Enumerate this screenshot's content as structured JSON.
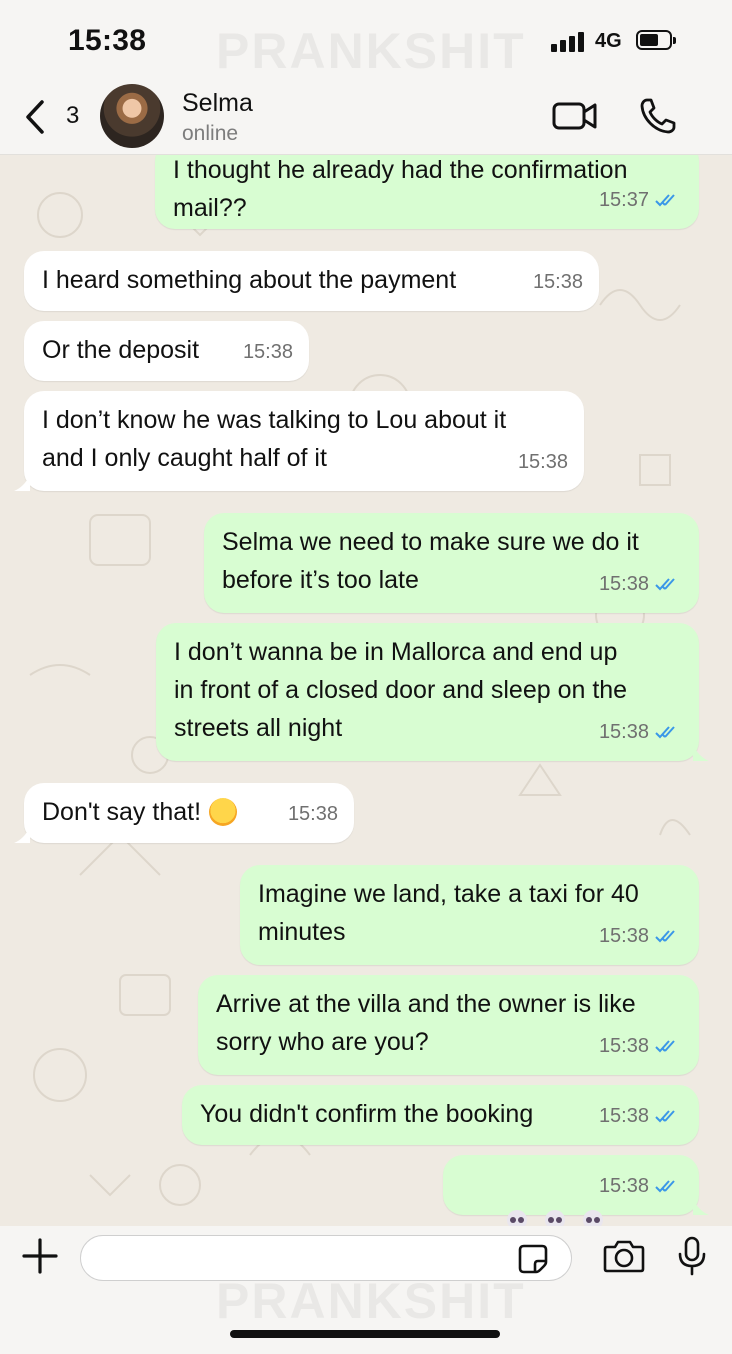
{
  "status_bar": {
    "time": "15:38",
    "network": "4G"
  },
  "watermark": "PRANKSHIT",
  "header": {
    "back_count": "3",
    "contact_name": "Selma",
    "contact_status": "online"
  },
  "messages": [
    {
      "dir": "out",
      "text": "I thought he already had the confirmation\nmail??",
      "time": "15:37"
    },
    {
      "dir": "in",
      "text": "I heard something about the payment",
      "time": "15:38"
    },
    {
      "dir": "in",
      "text": "Or the deposit",
      "time": "15:38"
    },
    {
      "dir": "in",
      "text": "I don’t know he was talking to Lou about it\nand I only caught half of it",
      "time": "15:38"
    },
    {
      "dir": "out",
      "text": "Selma we need to make sure we do it\nbefore it’s too late",
      "time": "15:38"
    },
    {
      "dir": "out",
      "text": "I don’t wanna be in Mallorca and end up\nin front of a closed door and sleep on the\nstreets all night",
      "time": "15:38"
    },
    {
      "dir": "in",
      "text": "Don't say that!",
      "emoji": "grinning-sweat-emoji",
      "time": "15:38"
    },
    {
      "dir": "out",
      "text": "Imagine we land, take a taxi for 40\nminutes",
      "time": "15:38"
    },
    {
      "dir": "out",
      "text": "Arrive at the villa and the owner is like\nsorry who are you?",
      "time": "15:38"
    },
    {
      "dir": "out",
      "text": "You didn't confirm the booking",
      "time": "15:38"
    },
    {
      "dir": "out",
      "text": "",
      "emoji": "skull-emoji ×3",
      "time": "15:38"
    }
  ],
  "colors": {
    "outgoing_bubble": "#d8fdd2",
    "incoming_bubble": "#ffffff",
    "read_ticks": "#3a97e8",
    "chat_background": "#efeae2"
  },
  "icons": [
    "back-chevron-icon",
    "video-call-icon",
    "phone-icon",
    "plus-icon",
    "sticker-icon",
    "camera-icon",
    "mic-icon",
    "double-check-icon"
  ]
}
